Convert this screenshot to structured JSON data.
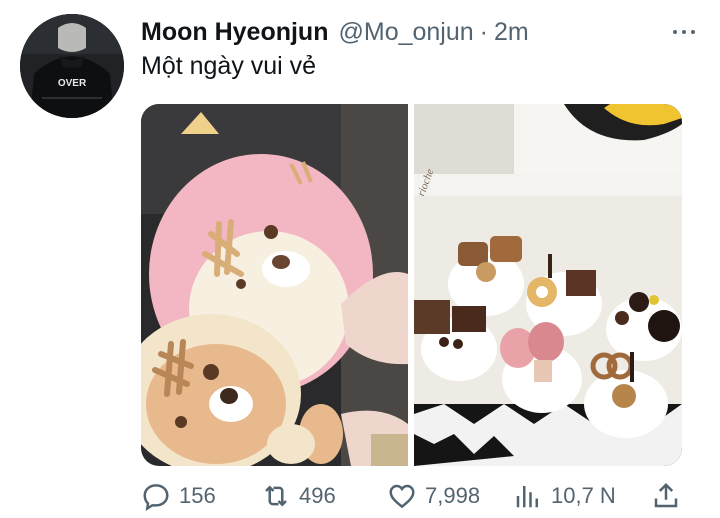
{
  "tweet": {
    "display_name": "Moon Hyeonjun",
    "handle": "@Mo_onjun",
    "separator": "·",
    "time": "2m",
    "text": "Một ngày vui vẻ"
  },
  "avatar": {
    "jacket_text": "OVER"
  },
  "media": {
    "count": 2,
    "photos": [
      "plush-toys-photo",
      "cupcakes-box-photo"
    ],
    "box_text": "brioche"
  },
  "actions": {
    "reply_count": "156",
    "retweet_count": "496",
    "like_count": "7,998",
    "views_count": "10,7 N"
  },
  "colors": {
    "text": "#0f1419",
    "secondary": "#536471",
    "background": "#ffffff"
  }
}
